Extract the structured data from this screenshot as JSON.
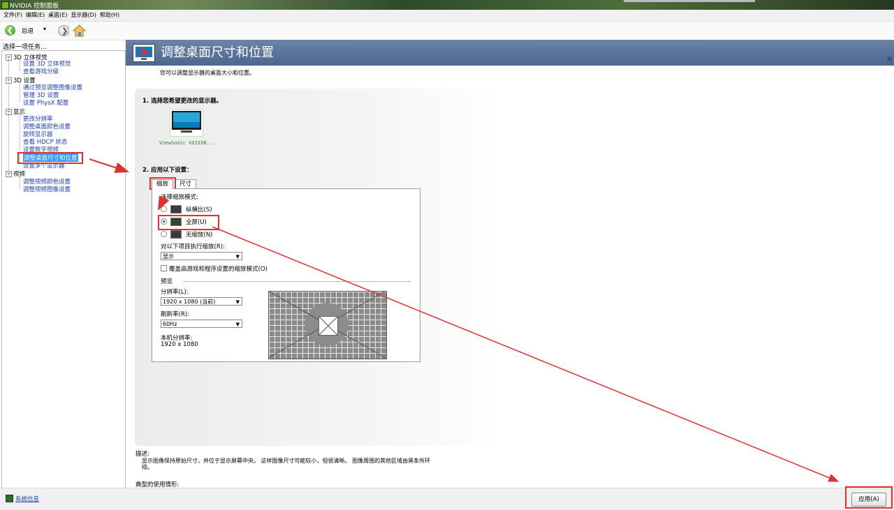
{
  "window": {
    "title": "NVIDIA 控制面板"
  },
  "menu": [
    "文件(F)",
    "编辑(E)",
    "桌面(E)",
    "显示器(D)",
    "帮助(H)"
  ],
  "toolbar": {
    "back_label": "后退"
  },
  "left": {
    "task_title": "选择一项任务...",
    "categories": [
      {
        "label": "3D 立体视觉",
        "items": [
          "设置 3D 立体视觉",
          "查看游戏分级"
        ]
      },
      {
        "label": "3D 设置",
        "items": [
          "通过预览调整图像设置",
          "管理 3D 设置",
          "设置 PhysX 配置"
        ]
      },
      {
        "label": "显示",
        "items": [
          "更改分辨率",
          "调整桌面颜色设置",
          "旋转显示器",
          "查看 HDCP 状态",
          "设置数字视频",
          "调整桌面尺寸和位置",
          "设置多个显示器"
        ]
      },
      {
        "label": "视频",
        "items": [
          "调整视频颜色设置",
          "调整视频图像设置"
        ]
      }
    ]
  },
  "main": {
    "title": "调整桌面尺寸和位置",
    "restore": "恢",
    "subtitle": "您可以调整显示器的桌面大小和位置。",
    "step1": "1. 选择您希望更改的显示器。",
    "monitor_name": "ViewSonic VX2338...",
    "step2": "2. 应用以下设置：",
    "tabs": [
      "缩放",
      "尺寸"
    ],
    "scaling_mode_label": "选择缩放模式:",
    "modes": [
      "纵横比(S)",
      "全屏(U)",
      "无缩放(N)"
    ],
    "selected_mode": "全屏(U)",
    "perform_on_label": "对以下项目执行缩放(R):",
    "perform_on_value": "显示",
    "override_label": "覆盖由游戏和程序设置的缩放模式(O)",
    "preview_label": "预览",
    "resolution_label": "分辨率(L):",
    "resolution_value": "1920 x 1080 (当前)",
    "refresh_label": "刷新率(R):",
    "refresh_value": "60Hz",
    "native_label": "本机分辨率:",
    "native_value": "1920 x 1080"
  },
  "description": {
    "label": "描述:",
    "text": "显示图像保持原始尺寸，并位于显示屏幕中央。 这样图像尺寸可能较小，但很清晰。 图像周围的其他区域由黑条所环绕。",
    "typical_label": "典型的使用情形:"
  },
  "footer": {
    "sysinfo": "系统信息",
    "apply": "应用(A)"
  },
  "colors": {
    "annotation_red": "#e03030",
    "header_blue": "#5a729c",
    "nvidia_green": "#76b900",
    "link_blue": "#1a3fbf"
  }
}
